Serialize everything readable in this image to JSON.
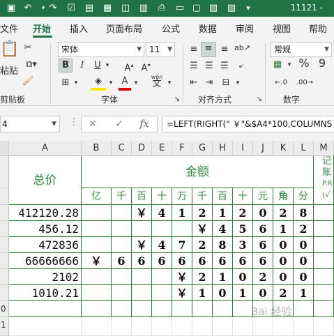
{
  "titlebar": {
    "doc_title": "11121 -"
  },
  "tabs": [
    "文件",
    "开始",
    "插入",
    "页面布局",
    "公式",
    "数据",
    "审阅",
    "视图",
    "帮助"
  ],
  "ribbon": {
    "paste_label": "粘贴",
    "font_name": "宋体",
    "font_size": "11",
    "bold": "B",
    "italic": "I",
    "underline": "U",
    "wen_label": "wén",
    "number_format": "常规",
    "percent": "%",
    "comma": "9",
    "groups": [
      "剪贴板",
      "字体",
      "对齐方式",
      "数字"
    ]
  },
  "formula_bar": {
    "name_box": "4",
    "formula": "=LEFT(RIGHT(\" ￥\"&$A4*100,COLUMNS"
  },
  "columns": [
    "A",
    "B",
    "C",
    "D",
    "E",
    "F",
    "G",
    "H",
    "I",
    "J",
    "K",
    "L",
    "M"
  ],
  "sheet": {
    "header_total": "总价",
    "header_amount": "金额",
    "header_m_lines": [
      "记",
      "账",
      "P.R",
      "(√"
    ],
    "units": [
      "亿",
      "千",
      "百",
      "十",
      "万",
      "千",
      "百",
      "十",
      "元",
      "角",
      "分"
    ],
    "rows": [
      {
        "total": "412120.28",
        "digits": [
          "",
          "",
          "￥",
          "4",
          "1",
          "2",
          "1",
          "2",
          "0",
          "2",
          "8"
        ]
      },
      {
        "total": "456.12",
        "digits": [
          "",
          "",
          "",
          "",
          "",
          "￥",
          "4",
          "5",
          "6",
          "1",
          "2"
        ]
      },
      {
        "total": "472836",
        "digits": [
          "",
          "",
          "￥",
          "4",
          "7",
          "2",
          "8",
          "3",
          "6",
          "0",
          "0"
        ]
      },
      {
        "total": "66666666",
        "digits": [
          "￥",
          "6",
          "6",
          "6",
          "6",
          "6",
          "6",
          "6",
          "6",
          "0",
          "0"
        ]
      },
      {
        "total": "2102",
        "digits": [
          "",
          "",
          "",
          "",
          "￥",
          "2",
          "1",
          "0",
          "2",
          "0",
          "0"
        ]
      },
      {
        "total": "1010.21",
        "digits": [
          "",
          "",
          "",
          "",
          "￥",
          "1",
          "0",
          "1",
          "0",
          "2",
          "1"
        ]
      }
    ],
    "row_numbers_bottom": [
      "0",
      "1"
    ]
  },
  "watermark": "Bai 经验"
}
